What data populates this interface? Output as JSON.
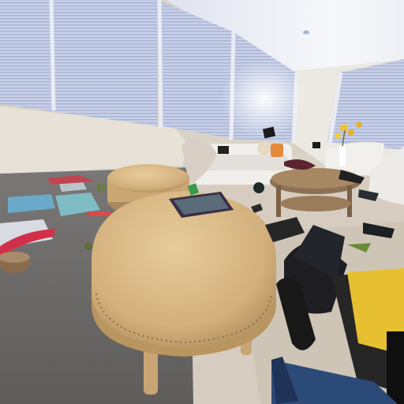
{
  "scene": {
    "kind": "rendered 3D interior: office lounge with scattered floating objects",
    "palette": {
      "ceiling": "#f2f3f6",
      "wall": "#e9e4dc",
      "blinds": "#c9d2e8",
      "carpet": "#6e6c6a",
      "rug": "#d8cfc2",
      "ottoman": "#d9b886",
      "ottoman_shadow": "#a98a5e",
      "sofa": "#f1efec",
      "table": "#8a6e52"
    }
  }
}
